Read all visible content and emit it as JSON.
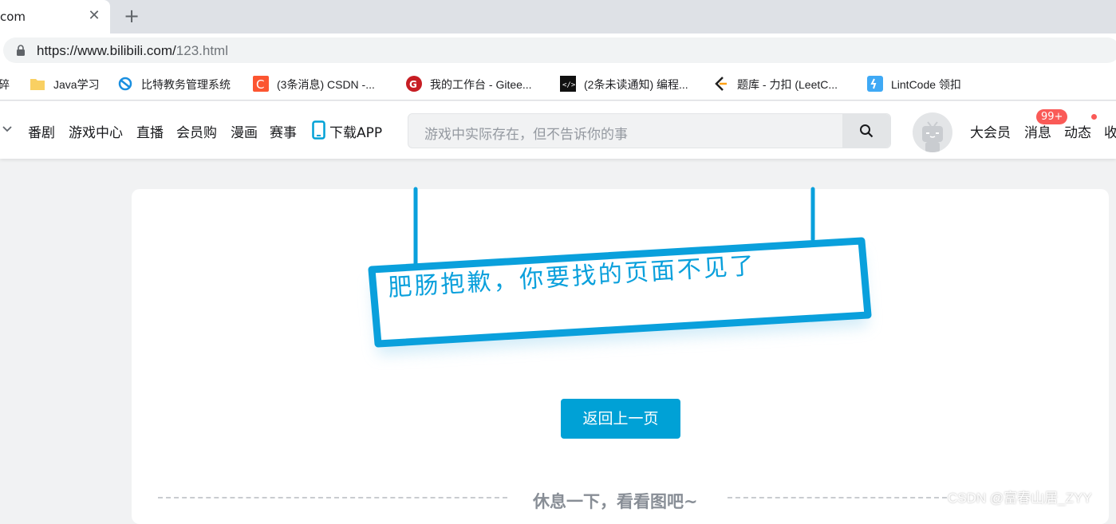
{
  "browser": {
    "tab_title": "com",
    "url_domain": "https://www.bilibili.com/",
    "url_path": "123.html"
  },
  "bookmarks": [
    {
      "label": "碎",
      "icon": "folder-icon"
    },
    {
      "label": "Java学习",
      "icon": "folder-icon"
    },
    {
      "label": "比特教务管理系统",
      "icon": "edu-icon"
    },
    {
      "label": "(3条消息) CSDN -...",
      "icon": "csdn-icon"
    },
    {
      "label": "我的工作台 - Gitee...",
      "icon": "gitee-icon"
    },
    {
      "label": "(2条未读通知) 编程...",
      "icon": "code-icon"
    },
    {
      "label": "题库 - 力扣 (LeetC...",
      "icon": "leetcode-icon"
    },
    {
      "label": "LintCode 领扣",
      "icon": "lintcode-icon"
    }
  ],
  "header": {
    "nav": [
      "番剧",
      "游戏中心",
      "直播",
      "会员购",
      "漫画",
      "赛事",
      "下载APP"
    ],
    "search_placeholder": "游戏中实际存在，但不告诉你的事",
    "right": [
      "大会员",
      "消息",
      "动态",
      "收"
    ],
    "message_badge": "99+"
  },
  "main": {
    "sign_text": "肥肠抱歉，你要找的页面不见了",
    "back_button": "返回上一页",
    "rest_title": "休息一下，看看图吧~"
  },
  "watermark": "CSDN @富春山居_ZYY",
  "colors": {
    "brand_blue": "#00a1d6",
    "badge_red": "#fa5a57"
  }
}
